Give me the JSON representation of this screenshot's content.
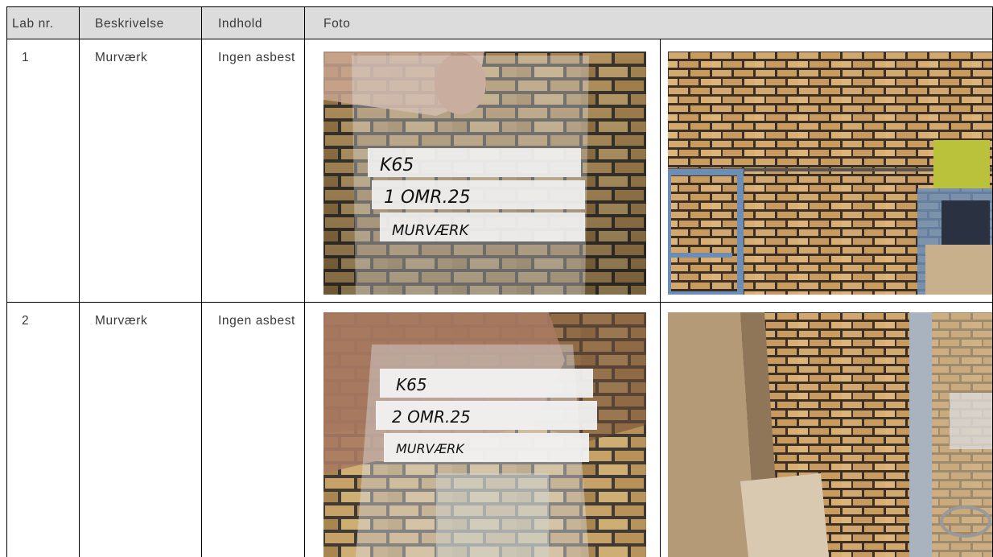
{
  "table": {
    "headers": [
      "Lab nr.",
      "Beskrivelse",
      "Indhold",
      "Foto"
    ],
    "rows": [
      {
        "lab_nr": "1",
        "beskrivelse": "Murværk",
        "indhold": "Ingen asbest",
        "photos": [
          {
            "icon": "sample-bag-photo",
            "label_lines": [
              "K65",
              "1 OMR.25",
              "MURVÆRK"
            ]
          },
          {
            "icon": "brick-wall-shelf-photo"
          }
        ]
      },
      {
        "lab_nr": "2",
        "beskrivelse": "Murværk",
        "indhold": "Ingen asbest",
        "photos": [
          {
            "icon": "sample-bag-photo",
            "label_lines": [
              "K65",
              "2 OMR.25",
              "MURVÆRK"
            ]
          },
          {
            "icon": "brick-wall-corner-photo"
          }
        ]
      }
    ]
  },
  "colors": {
    "header_bg": "#dcdcdc",
    "grid": "#000000",
    "brick": "#c9a067",
    "mortar": "#3f3a33",
    "shelf": "#6d8db5"
  }
}
